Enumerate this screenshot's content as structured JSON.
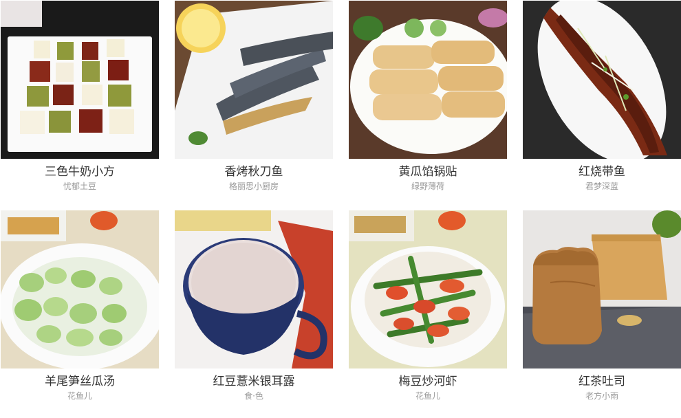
{
  "recipes": [
    {
      "title": "三色牛奶小方",
      "author": "忧郁土豆",
      "image": "tricolor-milk-squares-photo"
    },
    {
      "title": "香烤秋刀鱼",
      "author": "格丽思小厨房",
      "image": "grilled-saury-photo"
    },
    {
      "title": "黄瓜馅锅贴",
      "author": "绿野薄荷",
      "image": "cucumber-potstickers-photo"
    },
    {
      "title": "红烧带鱼",
      "author": "君梦深蓝",
      "image": "braised-hairtail-photo"
    },
    {
      "title": "羊尾笋丝瓜汤",
      "author": "花鱼儿",
      "image": "loofah-soup-photo"
    },
    {
      "title": "红豆薏米银耳露",
      "author": "食·色",
      "image": "red-bean-drink-photo"
    },
    {
      "title": "梅豆炒河虾",
      "author": "花鱼儿",
      "image": "beans-shrimp-photo"
    },
    {
      "title": "红茶吐司",
      "author": "老方小雨",
      "image": "black-tea-toast-photo"
    }
  ]
}
